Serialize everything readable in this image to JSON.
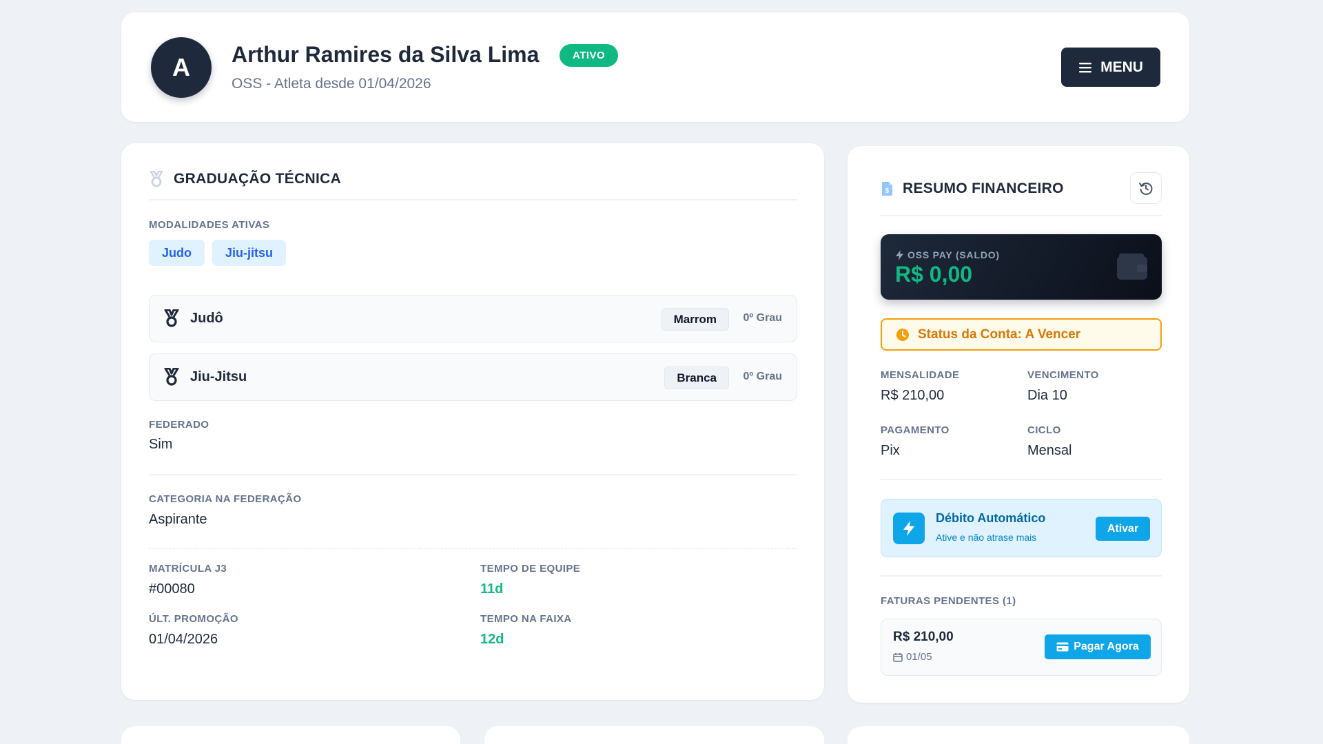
{
  "header": {
    "avatar_initial": "A",
    "athlete_name": "Arthur Ramires da Silva Lima",
    "status": "ATIVO",
    "subtitle": "OSS - Atleta desde 01/04/2026",
    "menu_label": "MENU"
  },
  "graduation": {
    "title": "GRADUAÇÃO TÉCNICA",
    "modalities_label": "MODALIDADES ATIVAS",
    "modalities": [
      "Judo",
      "Jiu-jitsu"
    ],
    "belts": [
      {
        "name": "Judô",
        "belt": "Marrom",
        "degree": "0º Grau"
      },
      {
        "name": "Jiu-Jitsu",
        "belt": "Branca",
        "degree": "0º Grau"
      }
    ],
    "federated_label": "FEDERADO",
    "federated_value": "Sim",
    "category_label": "CATEGORIA NA FEDERAÇÃO",
    "category_value": "Aspirante",
    "registration_label": "MATRÍCULA J3",
    "registration_value": "#00080",
    "team_time_label": "TEMPO DE EQUIPE",
    "team_time_value": "11d",
    "last_promotion_label": "ÚLT. PROMOÇÃO",
    "last_promotion_value": "01/04/2026",
    "belt_time_label": "TEMPO NA FAIXA",
    "belt_time_value": "12d"
  },
  "finance": {
    "title": "RESUMO FINANCEIRO",
    "wallet_label": "OSS PAY (SALDO)",
    "wallet_value": "R$ 0,00",
    "account_status": "Status da Conta: A Vencer",
    "monthly_label": "MENSALIDADE",
    "monthly_value": "R$ 210,00",
    "due_label": "VENCIMENTO",
    "due_value": "Dia 10",
    "payment_label": "PAGAMENTO",
    "payment_value": "Pix",
    "cycle_label": "CICLO",
    "cycle_value": "Mensal",
    "autodebit_title": "Débito Automático",
    "autodebit_sub": "Ative e não atrase mais",
    "autodebit_button": "Ativar",
    "pending_label": "FATURAS PENDENTES (1)",
    "invoice_amount": "R$ 210,00",
    "invoice_date": "01/05",
    "pay_button": "Pagar Agora"
  },
  "colors": {
    "primary_dark": "#1e293b",
    "success": "#10b981",
    "info": "#0ea5e9",
    "warning": "#d97706"
  }
}
